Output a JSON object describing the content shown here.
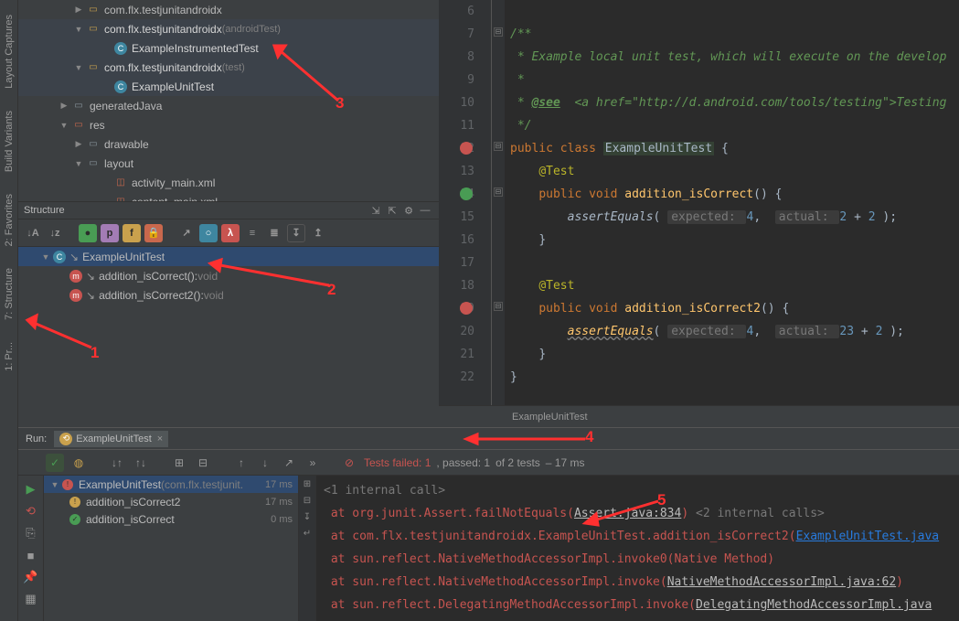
{
  "sidebar": {
    "tabs": [
      "Layout Captures",
      "Build Variants",
      "2: Favorites",
      "7: Structure",
      "1: Pr..."
    ]
  },
  "project": {
    "rows": [
      {
        "ind": 60,
        "arrow": "▶",
        "icon": "pkg",
        "text": "com.flx.testjunitandroidx",
        "scope": ""
      },
      {
        "ind": 60,
        "arrow": "▼",
        "icon": "pkg",
        "text": "com.flx.testjunitandroidx",
        "scope": "(androidTest)",
        "sel": true
      },
      {
        "ind": 90,
        "arrow": "",
        "icon": "class",
        "text": "ExampleInstrumentedTest",
        "sel": true
      },
      {
        "ind": 60,
        "arrow": "▼",
        "icon": "pkg",
        "text": "com.flx.testjunitandroidx",
        "scope": "(test)",
        "sel": true
      },
      {
        "ind": 90,
        "arrow": "",
        "icon": "class",
        "text": "ExampleUnitTest",
        "sel": true
      },
      {
        "ind": 44,
        "arrow": "▶",
        "icon": "gen",
        "text": "generatedJava"
      },
      {
        "ind": 44,
        "arrow": "▼",
        "icon": "res",
        "text": "res"
      },
      {
        "ind": 60,
        "arrow": "▶",
        "icon": "dir",
        "text": "drawable"
      },
      {
        "ind": 60,
        "arrow": "▼",
        "icon": "dir",
        "text": "layout"
      },
      {
        "ind": 90,
        "arrow": "",
        "icon": "xml",
        "text": "activity_main.xml"
      },
      {
        "ind": 90,
        "arrow": "",
        "icon": "xml",
        "text": "content_main.xml"
      }
    ]
  },
  "structure": {
    "title": "Structure",
    "rows": [
      {
        "ind": 24,
        "arrow": "▼",
        "icon": "class",
        "text": "ExampleUnitTest",
        "sel": true
      },
      {
        "ind": 56,
        "arrow": "",
        "icon": "method",
        "text": "addition_isCorrect(): ",
        "ret": "void"
      },
      {
        "ind": 56,
        "arrow": "",
        "icon": "method",
        "text": "addition_isCorrect2(): ",
        "ret": "void"
      }
    ]
  },
  "editor": {
    "lines": [
      6,
      7,
      8,
      9,
      10,
      11,
      12,
      13,
      14,
      15,
      16,
      17,
      18,
      19,
      20,
      21,
      22
    ],
    "l7": "/**",
    "l8": " * Example local unit test, which will execute on the develop",
    "l9": " *",
    "l10a": " * ",
    "l10b": "@see",
    "l10c": "  <a href=\"http://d.android.com/tools/testing\">Testing ",
    "l11": " */",
    "l12a": "public",
    "l12b": "class",
    "l12c": "ExampleUnitTest",
    "l12d": " {",
    "l13": "@Test",
    "l14a": "public",
    "l14b": "void",
    "l14c": "addition_isCorrect",
    "l14d": "() {",
    "l15a": "assertEquals",
    "l15b": "( ",
    "l15h1": "expected: ",
    "l15n1": "4",
    "l15c": ",  ",
    "l15h2": "actual: ",
    "l15n2": "2",
    "l15p": " + ",
    "l15n3": "2",
    "l15e": " );",
    "l16": "}",
    "l18": "@Test",
    "l19a": "public",
    "l19b": "void",
    "l19c": "addition_isCorrect2",
    "l19d": "() {",
    "l20a": "assertEquals",
    "l20b": "( ",
    "l20h1": "expected: ",
    "l20n1": "4",
    "l20c": ",  ",
    "l20h2": "actual: ",
    "l20n2": "23",
    "l20p": " + ",
    "l20n3": "2",
    "l20e": " );",
    "l21": "}",
    "l22": "}",
    "crumb": "ExampleUnitTest"
  },
  "run": {
    "label": "Run:",
    "tab": "ExampleUnitTest",
    "status_fail": "Tests failed: 1",
    "status_pass": ", passed: 1",
    "status_total": " of 2 tests",
    "status_time": " – 17 ms"
  },
  "testtree": [
    {
      "icon": "fail",
      "text": "ExampleUnitTest",
      "dim": "(com.flx.testjunit.",
      "time": "17 ms",
      "sel": true,
      "ind": 6
    },
    {
      "icon": "warn",
      "text": "addition_isCorrect2",
      "time": "17 ms",
      "ind": 28
    },
    {
      "icon": "ok",
      "text": "addition_isCorrect",
      "time": "0 ms",
      "ind": 28
    }
  ],
  "console": {
    "l1a": "<1 internal call>",
    "l2a": "at org.junit.Assert.failNotEquals(",
    "l2b": "Assert.java:834",
    "l2c": ") ",
    "l2d": "<2 internal calls>",
    "l3a": "at com.flx.testjunitandroidx.ExampleUnitTest.addition_isCorrect2(",
    "l3b": "ExampleUnitTest.java",
    "l4a": "at sun.reflect.NativeMethodAccessorImpl.invoke0(Native Method)",
    "l5a": "at sun.reflect.NativeMethodAccessorImpl.invoke(",
    "l5b": "NativeMethodAccessorImpl.java:62",
    "l5c": ")",
    "l6a": "at sun.reflect.DelegatingMethodAccessorImpl.invoke(",
    "l6b": "DelegatingMethodAccessorImpl.java"
  },
  "annot": {
    "n1": "1",
    "n2": "2",
    "n3": "3",
    "n4": "4",
    "n5": "5"
  }
}
